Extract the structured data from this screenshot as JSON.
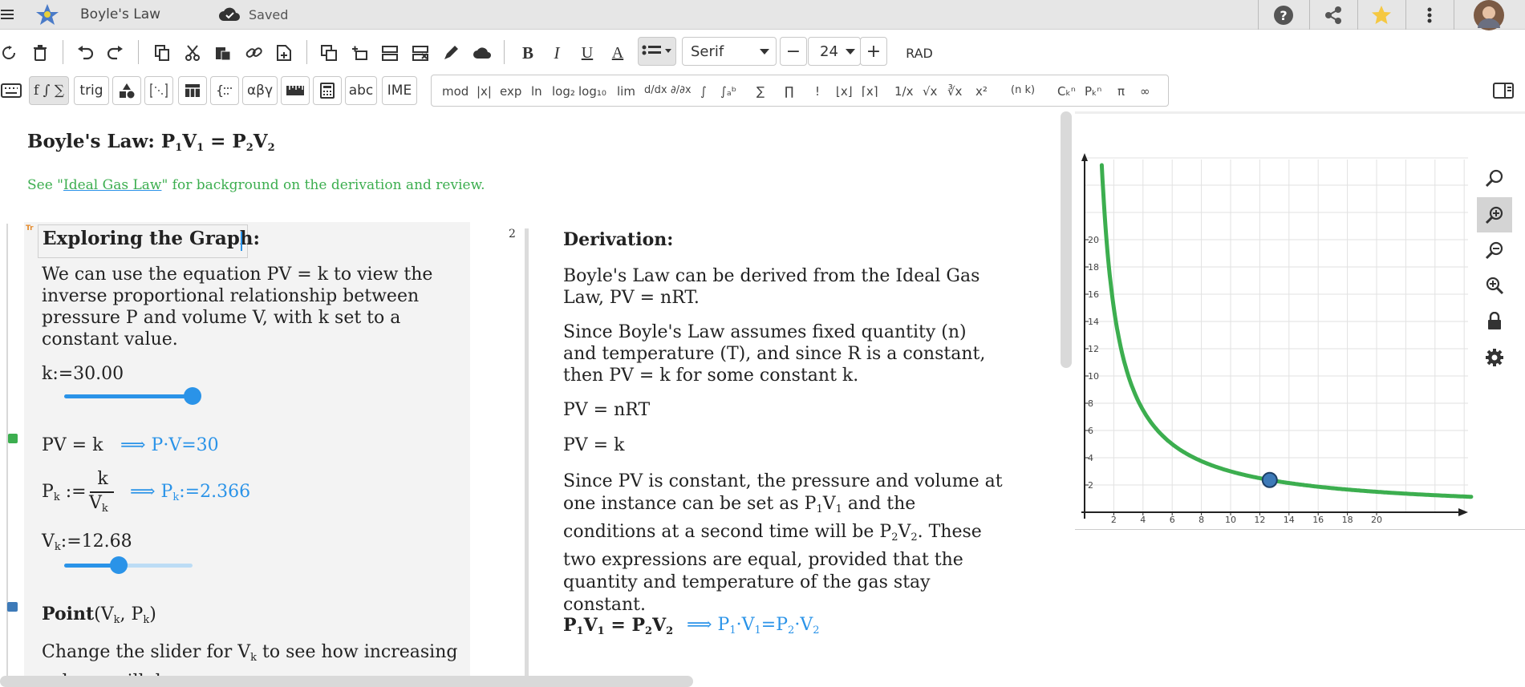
{
  "app": {
    "doc_title": "Boyle's Law",
    "save_status": "Saved"
  },
  "toolbar": {
    "bold": "B",
    "italic": "I",
    "underline": "U",
    "font_color": "A",
    "font_family": "Serif",
    "font_size": "24",
    "minus": "−",
    "plus": "+",
    "angle_mode": "RAD"
  },
  "toolbar2": {
    "functions": "f ∫ ∑",
    "trig": "trig",
    "greek": "αβγ",
    "abc": "abc",
    "ime": "IME",
    "palette": [
      "mod",
      "|x|",
      "exp",
      "ln",
      "log₂",
      "log₁₀",
      "lim",
      "d/dx",
      "∂/∂x",
      "∫",
      "∫ₐᵇ",
      "∑",
      "∏",
      "!",
      "⌊x⌋",
      "⌈x⌉",
      "1/x",
      "√x",
      "∛x",
      "x²",
      "(n k)",
      "Cₖⁿ",
      "Pₖⁿ",
      "π",
      "∞"
    ]
  },
  "document": {
    "heading_prefix": "Boyle's Law: P",
    "see_prefix": "See \"",
    "see_link": "Ideal Gas Law",
    "see_suffix": "\" for background on the derivation and review.",
    "left": {
      "title": "Exploring the Graph:",
      "region_number": "2",
      "intro": [
        "We can use the equation PV = k to view the",
        "inverse proportional relationship between",
        "pressure P and volume V, with k set to a",
        "constant value."
      ],
      "k_label": "k:=30.00",
      "k_value": 30.0,
      "k_max": 30,
      "pv_eq": "PV = k",
      "pv_result": "⟹ P·V=30",
      "pk_result_value": "2.366",
      "vk_label_value": "12.68",
      "vk_value": 12.68,
      "vk_max": 30,
      "point_fn": "Point",
      "change_prefix": "Change the slider for V",
      "change_suffix": " to see how increasing",
      "change_line2": "volume will decrease pressure."
    },
    "right": {
      "title": "Derivation:",
      "p1": [
        "Boyle's Law can be derived from the Ideal Gas",
        "Law, PV = nRT."
      ],
      "p2": [
        "Since Boyle's Law assumes fixed quantity (n)",
        "and temperature (T), and since R is a constant,",
        "then PV = k for some constant k."
      ],
      "eq1": "PV = nRT",
      "eq2": "PV = k",
      "p3_line1": "Since PV is constant, the pressure and volume at",
      "p3_line4": "two expressions are equal, provided that the",
      "p3_line5": "quantity and temperature of the gas stay",
      "p3_line6": "constant."
    }
  },
  "chart_data": {
    "type": "line",
    "function": "P = 30 / V",
    "k": 30,
    "xlim": [
      0,
      26
    ],
    "ylim": [
      0,
      25
    ],
    "x_ticks": [
      2,
      4,
      6,
      8,
      10,
      12,
      14,
      16,
      18,
      20
    ],
    "y_ticks": [
      2,
      4,
      6,
      8,
      10,
      12,
      14,
      16,
      18,
      20
    ],
    "point": {
      "x": 12.68,
      "y": 2.366
    },
    "curve_color": "#3cae4f",
    "point_color": "#3d7ab8",
    "grid": true
  }
}
